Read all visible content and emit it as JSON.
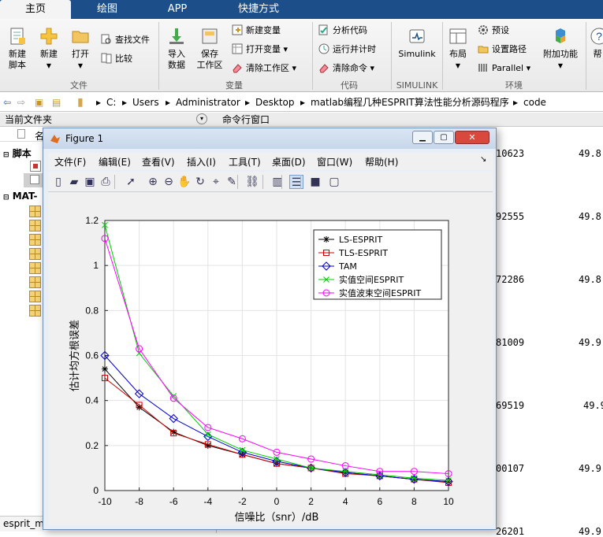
{
  "tabs": [
    {
      "label": "主页"
    },
    {
      "label": "绘图"
    },
    {
      "label": "APP"
    },
    {
      "label": "快捷方式"
    }
  ],
  "ribbon": {
    "file": {
      "new_script": "新建\n脚本",
      "new": "新建",
      "open": "打开",
      "find_files": "查找文件",
      "compare": "比较",
      "group": "文件"
    },
    "variable": {
      "import_data": "导入\n数据",
      "save_workspace": "保存\n工作区",
      "new_variable": "新建变量",
      "open_variable": "打开变量",
      "clear_workspace": "清除工作区",
      "group": "变量"
    },
    "code": {
      "analyze_code": "分析代码",
      "run_and_time": "运行并计时",
      "clear_commands": "清除命令",
      "group": "代码"
    },
    "simulink": {
      "label": "Simulink",
      "group": "SIMULINK"
    },
    "env": {
      "layout": "布局",
      "preferences": "预设",
      "set_path": "设置路径",
      "parallel": "Parallel",
      "addons": "附加功能",
      "group": "环境"
    },
    "help": {
      "label": "帮"
    }
  },
  "address": {
    "crumbs": [
      "C:",
      "Users",
      "Administrator",
      "Desktop",
      "matlab编程几种ESPRIT算法性能分析源码程序",
      "code"
    ]
  },
  "panes": {
    "current_folder": "当前文件夹",
    "command_window": "命令行窗口",
    "col_name": "名",
    "section_scripts": "脚本",
    "section_mat": "MAT-",
    "bottom_file": "esprit_m"
  },
  "cmd_values": {
    "col1": [
      "10623",
      "92555",
      "72286",
      "81009",
      "69519",
      "00107",
      "26201"
    ],
    "col2": [
      "49.8",
      "49.8",
      "49.8",
      "49.9",
      "49.9",
      "49.9",
      "49.9"
    ]
  },
  "figure": {
    "title": "Figure 1",
    "menu": [
      "文件(F)",
      "编辑(E)",
      "查看(V)",
      "插入(I)",
      "工具(T)",
      "桌面(D)",
      "窗口(W)",
      "帮助(H)"
    ],
    "icons": [
      "new-figure-icon",
      "open-icon",
      "save-icon",
      "print-icon",
      "pointer-icon",
      "zoom-in-icon",
      "zoom-out-icon",
      "pan-icon",
      "rotate-icon",
      "data-cursor-icon",
      "brush-icon",
      "link-icon",
      "colorbar-icon",
      "legend-icon",
      "hide-plot-tools-icon",
      "show-plot-tools-icon"
    ]
  },
  "chart_data": {
    "type": "line",
    "xlabel": "信噪比（snr）/dB",
    "ylabel": "估计均方根误差",
    "xlim": [
      -10,
      10
    ],
    "ylim": [
      0,
      1.2
    ],
    "x": [
      -10,
      -8,
      -6,
      -4,
      -2,
      0,
      2,
      4,
      6,
      8,
      10
    ],
    "xticks": [
      "-10",
      "-8",
      "-6",
      "-4",
      "-2",
      "0",
      "2",
      "4",
      "6",
      "8",
      "10"
    ],
    "yticks": [
      "0",
      "0.2",
      "0.4",
      "0.6",
      "0.8",
      "1",
      "1.2"
    ],
    "grid": true,
    "legend_position": "top-right",
    "series": [
      {
        "name": "LS-ESPRIT",
        "color": "#000000",
        "marker": "star",
        "values": [
          0.54,
          0.37,
          0.26,
          0.2,
          0.16,
          0.12,
          0.1,
          0.08,
          0.065,
          0.05,
          0.04
        ]
      },
      {
        "name": "TLS-ESPRIT",
        "color": "#cc0000",
        "marker": "square",
        "values": [
          0.5,
          0.38,
          0.255,
          0.205,
          0.16,
          0.12,
          0.1,
          0.075,
          0.065,
          0.05,
          0.035
        ]
      },
      {
        "name": "TAM",
        "color": "#0000cc",
        "marker": "diamond",
        "values": [
          0.6,
          0.43,
          0.32,
          0.24,
          0.17,
          0.13,
          0.1,
          0.08,
          0.065,
          0.05,
          0.04
        ]
      },
      {
        "name": "实值空间ESPRIT",
        "color": "#00cc00",
        "marker": "x",
        "values": [
          1.18,
          0.61,
          0.42,
          0.25,
          0.18,
          0.14,
          0.1,
          0.085,
          0.07,
          0.055,
          0.045
        ]
      },
      {
        "name": "实值波束空间ESPRIT",
        "color": "#ff00ff",
        "marker": "circle",
        "values": [
          1.12,
          0.63,
          0.41,
          0.28,
          0.23,
          0.17,
          0.14,
          0.11,
          0.085,
          0.085,
          0.075
        ]
      }
    ]
  }
}
